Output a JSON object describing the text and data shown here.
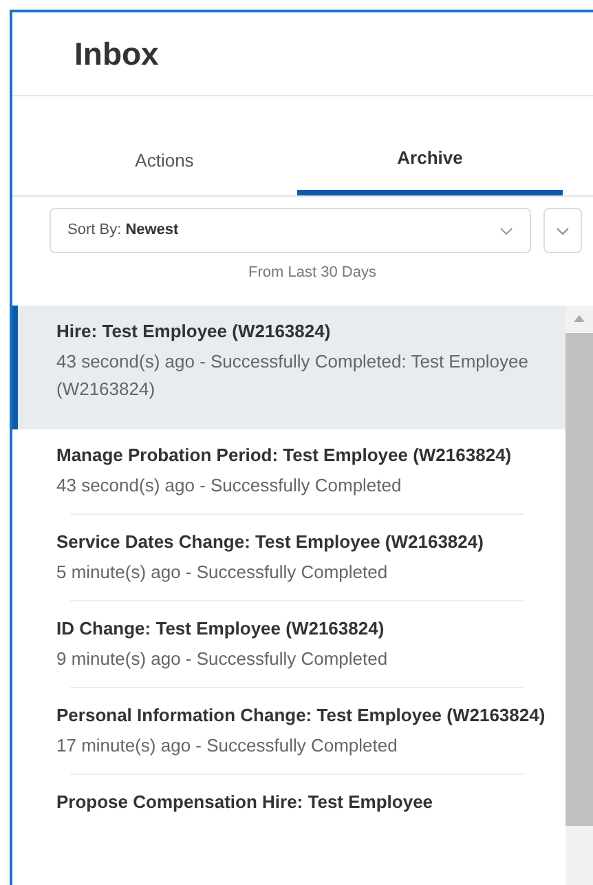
{
  "header": {
    "title": "Inbox"
  },
  "tabs": [
    {
      "label": "Actions",
      "selected": false
    },
    {
      "label": "Archive",
      "selected": true
    }
  ],
  "sort": {
    "label": "Sort By:",
    "value": "Newest"
  },
  "range_note": "From Last 30 Days",
  "items": [
    {
      "title": "Hire: Test Employee (W2163824)",
      "subtitle": "43 second(s) ago - Successfully Completed: Test Employee (W2163824)",
      "selected": true
    },
    {
      "title": "Manage Probation Period: Test Employee (W2163824)",
      "subtitle": "43 second(s) ago - Successfully Completed",
      "selected": false
    },
    {
      "title": "Service Dates Change: Test Employee (W2163824)",
      "subtitle": "5 minute(s) ago - Successfully Completed",
      "selected": false
    },
    {
      "title": "ID Change: Test Employee (W2163824)",
      "subtitle": "9 minute(s) ago - Successfully Completed",
      "selected": false
    },
    {
      "title": "Personal Information Change: Test Employee (W2163824)",
      "subtitle": "17 minute(s) ago - Successfully Completed",
      "selected": false
    },
    {
      "title": "Propose Compensation Hire: Test Employee",
      "selected": false
    }
  ]
}
